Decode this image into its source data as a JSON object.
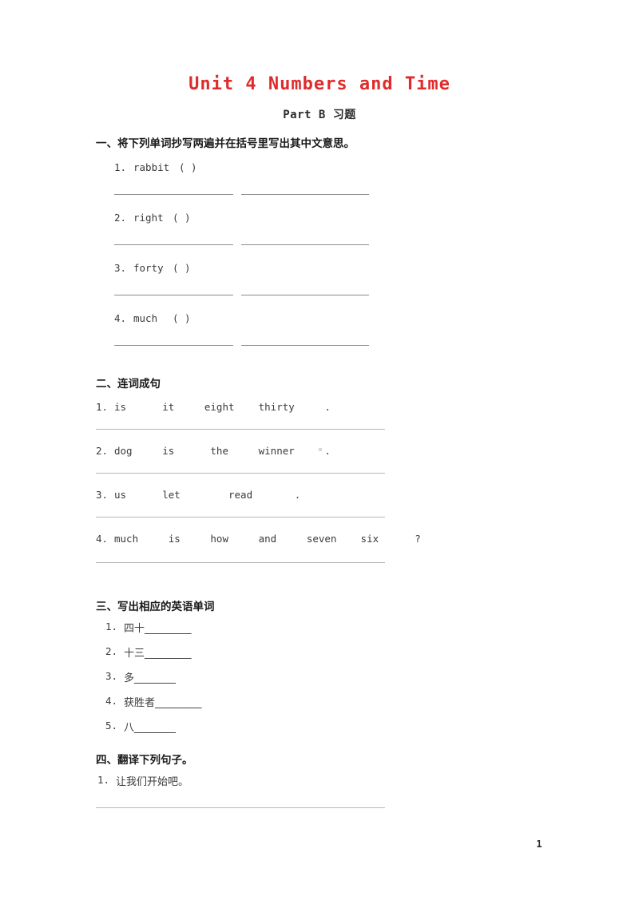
{
  "document": {
    "title": "Unit 4 Numbers and Time",
    "subtitle": "Part B 习题",
    "page_number": "1",
    "title_color": "#e02b2b",
    "text_color": "#3a3a3a",
    "background_color": "#ffffff"
  },
  "sections": [
    {
      "heading": "一、将下列单词抄写两遍并在括号里写出其中文意思。",
      "type": "copy-words",
      "items": [
        {
          "num": "1.",
          "word": "rabbit",
          "paren": "( )"
        },
        {
          "num": "2.",
          "word": "right",
          "paren": "( )"
        },
        {
          "num": "3.",
          "word": "forty",
          "paren": "( )"
        },
        {
          "num": "4.",
          "word": "much",
          "paren": "( )"
        }
      ]
    },
    {
      "heading": "二、连词成句",
      "type": "word-order",
      "items": [
        {
          "num": "1.",
          "words": "is      it     eight    thirty     ."
        },
        {
          "num": "2.",
          "words": "dog     is      the     winner     ."
        },
        {
          "num": "3.",
          "words": "us      let        read       ."
        },
        {
          "num": "4.",
          "words": "much     is     how     and     seven    six      ?"
        }
      ]
    },
    {
      "heading": "三、写出相应的英语单词",
      "type": "translate-words",
      "items": [
        {
          "num": "1.",
          "prompt": "四十_________"
        },
        {
          "num": "2.",
          "prompt": "十三_________"
        },
        {
          "num": "3.",
          "prompt": "多________"
        },
        {
          "num": "4.",
          "prompt": "获胜者_________"
        },
        {
          "num": "5.",
          "prompt": "八________"
        }
      ]
    },
    {
      "heading": "四、翻译下列句子。",
      "type": "translate-sentences",
      "items": [
        {
          "num": "1.",
          "prompt": "让我们开始吧。"
        }
      ]
    }
  ]
}
